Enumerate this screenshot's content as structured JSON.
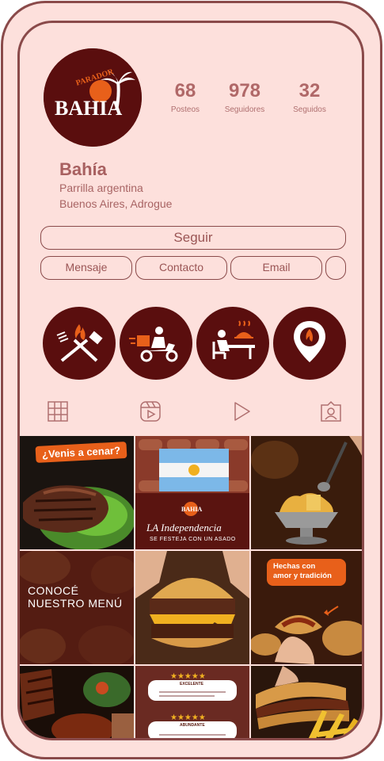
{
  "profile": {
    "logo_text_top": "PARADOR",
    "logo_text_main": "BAHIA",
    "name": "Bahía",
    "subtitle": "Parrilla argentina",
    "location": "Buenos Aires, Adrogue"
  },
  "stats": [
    {
      "value": "68",
      "label": "Posteos"
    },
    {
      "value": "978",
      "label": "Seguidores"
    },
    {
      "value": "32",
      "label": "Seguidos"
    }
  ],
  "buttons": {
    "follow": "Seguir",
    "message": "Mensaje",
    "contact": "Contacto",
    "email": "Email"
  },
  "highlights": [
    {
      "icon": "grill-tools-icon"
    },
    {
      "icon": "delivery-scooter-icon"
    },
    {
      "icon": "dining-table-icon"
    },
    {
      "icon": "location-pin-icon"
    }
  ],
  "tabs": [
    {
      "icon": "grid-icon"
    },
    {
      "icon": "reels-icon"
    },
    {
      "icon": "play-icon"
    },
    {
      "icon": "tagged-icon"
    }
  ],
  "posts": {
    "p1_badge": "¿Venis a cenar?",
    "p2_logo": "BAHIA",
    "p2_title": "LA Independencia",
    "p2_sub": "SE FESTEJA CON UN ASADO",
    "p4_line1": "CONOCÉ",
    "p4_line2": "NUESTRO MENÚ",
    "p6_badge1": "Hechas con",
    "p6_badge2": "amor y tradición",
    "p8_review1_title": "EXCELENTE",
    "p8_review2_title": "ABUNDANTE"
  },
  "colors": {
    "background": "#fde0dc",
    "brand": "#5a0e0e",
    "accent": "#e8601a",
    "border": "#8a4a4a",
    "text": "#a86060"
  }
}
